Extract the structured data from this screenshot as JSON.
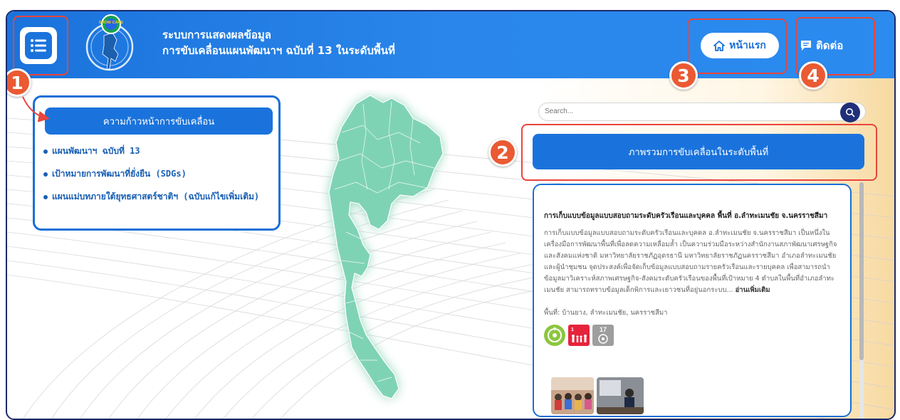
{
  "header": {
    "title_line1": "ระบบการแสดงผลข้อมูล",
    "title_line2": "การขับเคลื่อนแผนพัฒนาฯ ฉบับที่ 13 ในระดับพื้นที่",
    "logo_text": "SHOW CARE",
    "home_label": "หน้าแรก",
    "contact_label": "ติดต่อ"
  },
  "annotations": [
    "1",
    "2",
    "3",
    "4"
  ],
  "left_panel": {
    "heading": "ความก้าวหน้าการขับเคลื่อน",
    "items": [
      "แผนพัฒนาฯ ฉบับที่ 13",
      "เป้าหมายการพัฒนาที่ยั่งยืน (SDGs)",
      "แผนแม่บทภายใต้ยุทธศาสตร์ชาติฯ (ฉบับแก้ไขเพิ่มเติม)"
    ]
  },
  "search": {
    "placeholder": "Search..."
  },
  "overview_button": "ภาพรวมการขับเคลื่อนในระดับพื้นที่",
  "card": {
    "title": "การเก็บแบบข้อมูลแบบสอบถามระดับครัวเรือนและบุคคล พื้นที่ อ.ลำทะเมนชัย จ.นครราชสีมา",
    "body": "การเก็บแบบข้อมูลแบบสอบถามระดับครัวเรือนและบุคคล อ.ลำทะเมนชัย จ.นครราชสีมา เป็นหนึ่งในเครื่องมือการพัฒนาพื้นที่เพื่อลดความเหลื่อมล้ำ เป็นความร่วมมือระหว่างสำนักงานสภาพัฒนาเศรษฐกิจและสังคมแห่งชาติ มหาวิทยาลัยราชภัฏอุดรธานี มหาวิทยาลัยราชภัฏนครราชสีมา อำเภอลำทะเมนชัยและผู้นำชุมชน จุดประสงค์เพื่อจัดเก็บข้อมูลแบบสอบถามรายครัวเรือนและรายบุคคล เพื่อสามารถนำข้อมูลมาวิเคราะห์สภาพเศรษฐกิจ-สังคมระดับครัวเรือนของพื้นที่เป้าหมาย 4 ตำบลในพื้นที่อำเภอลำทะเมนชัย สามารถทราบข้อมูลเด็กพิการและเยาวชนที่อยู่นอกระบบ...",
    "read_more": "อ่านเพิ่มเติม",
    "location": "พื้นที่: บ้านยาง, ลำทะเมนชัย, นครราชสีมา",
    "sdg_badges": [
      "9",
      "1",
      "17"
    ]
  },
  "colors": {
    "primary": "#1a73dc",
    "accent_red": "#e9453b",
    "navy": "#1f2f7a"
  }
}
